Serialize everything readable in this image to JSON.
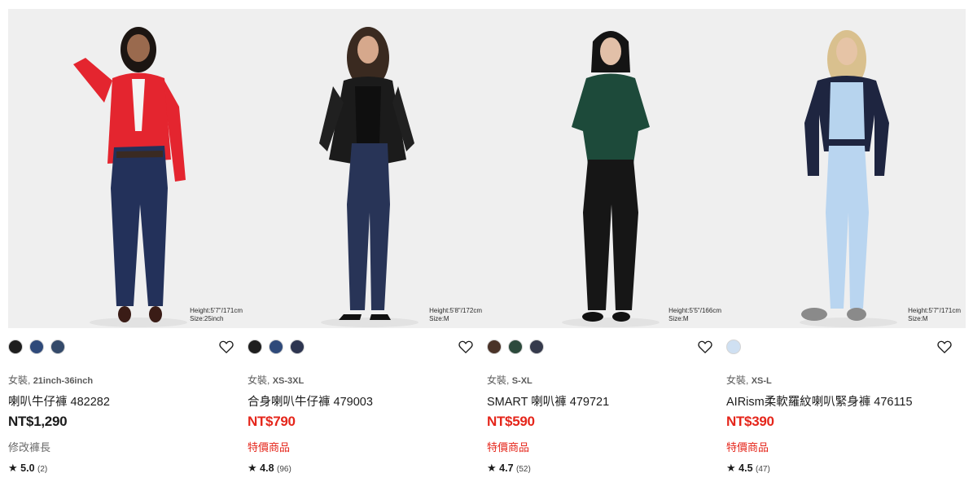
{
  "products": [
    {
      "model_info": [
        "Height:5'7\"/171cm",
        "Size:25inch"
      ],
      "swatches": [
        "#1e1e1e",
        "#2f4a7a",
        "#344a6a"
      ],
      "gender": "女裝,",
      "size_range": "21inch-36inch",
      "name": "喇叭牛仔褲 482282",
      "price": "NT$1,290",
      "flag": "修改褲長",
      "star": "★",
      "score": "5.0",
      "count": "(2)"
    },
    {
      "model_info": [
        "Height:5'8\"/172cm",
        "Size:M"
      ],
      "swatches": [
        "#1e1e1e",
        "#2f4a7a",
        "#2d3550"
      ],
      "gender": "女裝,",
      "size_range": "XS-3XL",
      "name": "合身喇叭牛仔褲 479003",
      "price": "NT$790",
      "flag": "特價商品",
      "star": "★",
      "score": "4.8",
      "count": "(96)"
    },
    {
      "model_info": [
        "Height:5'5\"/166cm",
        "Size:M"
      ],
      "swatches": [
        "#4a3328",
        "#2c4a3c",
        "#353a4c"
      ],
      "gender": "女裝,",
      "size_range": "S-XL",
      "name": "SMART 喇叭褲 479721",
      "price": "NT$590",
      "flag": "特價商品",
      "star": "★",
      "score": "4.7",
      "count": "(52)"
    },
    {
      "model_info": [
        "Height:5'7\"/171cm",
        "Size:M"
      ],
      "swatches": [
        "#cfe0f2"
      ],
      "gender": "女裝,",
      "size_range": "XS-L",
      "name": "AIRism柔軟羅紋喇叭緊身褲 476115",
      "price": "NT$390",
      "flag": "特價商品",
      "star": "★",
      "score": "4.5",
      "count": "(47)"
    }
  ]
}
